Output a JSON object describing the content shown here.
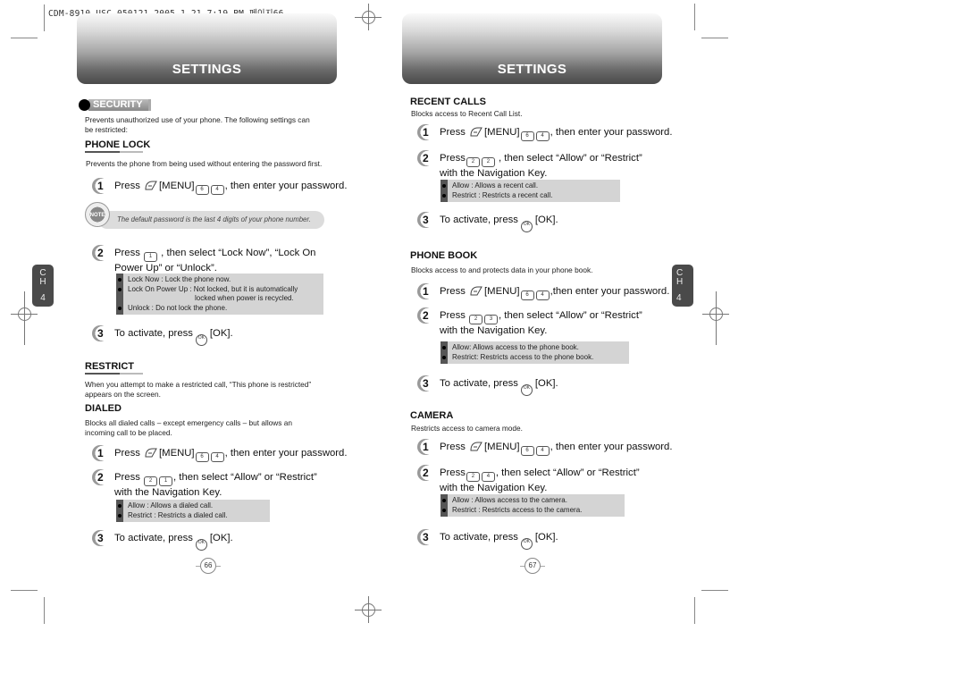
{
  "print_header": "CDM-8910_USC_050121  2005.1.21 7:19 PM 페이지66",
  "left_page": {
    "banner_title": "SETTINGS",
    "chapter_tab": {
      "ch": "C\nH",
      "c": "C",
      "h": "H",
      "num": "4"
    },
    "security": {
      "tag": "SECURITY",
      "intro_line1": "Prevents unauthorized use of your phone. The following settings can",
      "intro_line2": "be restricted:"
    },
    "phone_lock": {
      "heading": "PHONE LOCK",
      "desc": "Prevents the phone from being used without entering the password first.",
      "step1": {
        "num": "1",
        "pre": "Press",
        "menu": "[MENU]",
        "key1": "6",
        "key2": "4",
        "post": ", then enter your password."
      },
      "note": {
        "icon_label": "NOTE",
        "text": "The default password is the last 4 digits of your phone number."
      },
      "step2": {
        "num": "2",
        "pre": "Press",
        "key1": "1",
        "line1_post": " , then select “Lock Now”, “Lock On",
        "line2": "Power Up” or “Unlock”."
      },
      "bullets": [
        "Lock Now : Lock the phone now.",
        "Lock On Power Up : Not locked, but it is automatically",
        "locked when power is recycled.",
        "Unlock : Do not lock the phone."
      ],
      "step3": {
        "num": "3",
        "pre": "To activate, press",
        "ok_label": "OK",
        "post": "[OK]."
      }
    },
    "restrict": {
      "heading": "RESTRICT",
      "desc_line1": "When you attempt to make a restricted call, “This phone is restricted”",
      "desc_line2": "appears on the screen."
    },
    "dialed": {
      "heading": "DIALED",
      "desc_line1": "Blocks all dialed calls – except emergency calls – but allows an",
      "desc_line2": "incoming call to be placed.",
      "step1": {
        "num": "1",
        "pre": "Press",
        "menu": "[MENU]",
        "key1": "6",
        "key2": "4",
        "post": ", then enter your password."
      },
      "step2": {
        "num": "2",
        "pre": "Press",
        "key1": "2",
        "key2": "1",
        "line1_post": ", then select “Allow” or “Restrict”",
        "line2": "with the Navigation Key."
      },
      "bullets": [
        "Allow : Allows a dialed call.",
        "Restrict : Restricts a dialed call."
      ],
      "step3": {
        "num": "3",
        "pre": "To activate, press",
        "ok_label": "OK",
        "post": "[OK]."
      }
    },
    "page_number": "66"
  },
  "right_page": {
    "banner_title": "SETTINGS",
    "chapter_tab": {
      "c": "C",
      "h": "H",
      "num": "4"
    },
    "recent_calls": {
      "heading": "RECENT CALLS",
      "desc": "Blocks access to Recent Call List.",
      "step1": {
        "num": "1",
        "pre": "Press",
        "menu": "[MENU]",
        "key1": "6",
        "key2": "4",
        "post": ", then enter your password."
      },
      "step2": {
        "num": "2",
        "pre": "Press",
        "key1": "2",
        "key2": "2",
        "line1_post": " , then select “Allow” or “Restrict”",
        "line2": "with the Navigation Key."
      },
      "bullets": [
        "Allow : Allows a recent call.",
        "Restrict : Restricts a recent call."
      ],
      "step3": {
        "num": "3",
        "pre": "To activate, press",
        "ok_label": "OK",
        "post": "[OK]."
      }
    },
    "phone_book": {
      "heading": "PHONE BOOK",
      "desc": "Blocks access to and protects data in your phone book.",
      "step1": {
        "num": "1",
        "pre": "Press",
        "menu": "[MENU]",
        "key1": "6",
        "key2": "4",
        "post": ",then enter your password."
      },
      "step2": {
        "num": "2",
        "pre": "Press",
        "key1": "2",
        "key2": "3",
        "line1_post": ", then select “Allow” or “Restrict”",
        "line2": "with the Navigation Key."
      },
      "bullets": [
        "Allow: Allows access to the phone book.",
        "Restrict: Restricts access to the phone book."
      ],
      "step3": {
        "num": "3",
        "pre": "To activate, press",
        "ok_label": "OK",
        "post": "[OK]."
      }
    },
    "camera": {
      "heading": "CAMERA",
      "desc": "Restricts access to camera mode.",
      "step1": {
        "num": "1",
        "pre": "Press",
        "menu": "[MENU]",
        "key1": "6",
        "key2": "4",
        "post": ", then enter your password."
      },
      "step2": {
        "num": "2",
        "pre": "Press",
        "key1": "2",
        "key2": "4",
        "line1_post": ", then select “Allow” or “Restrict”",
        "line2": "with the Navigation Key."
      },
      "bullets": [
        "Allow : Allows access to the camera.",
        "Restrict : Restricts access to the camera."
      ],
      "step3": {
        "num": "3",
        "pre": "To activate, press",
        "ok_label": "OK",
        "post": "[OK]."
      }
    },
    "page_number": "67"
  }
}
